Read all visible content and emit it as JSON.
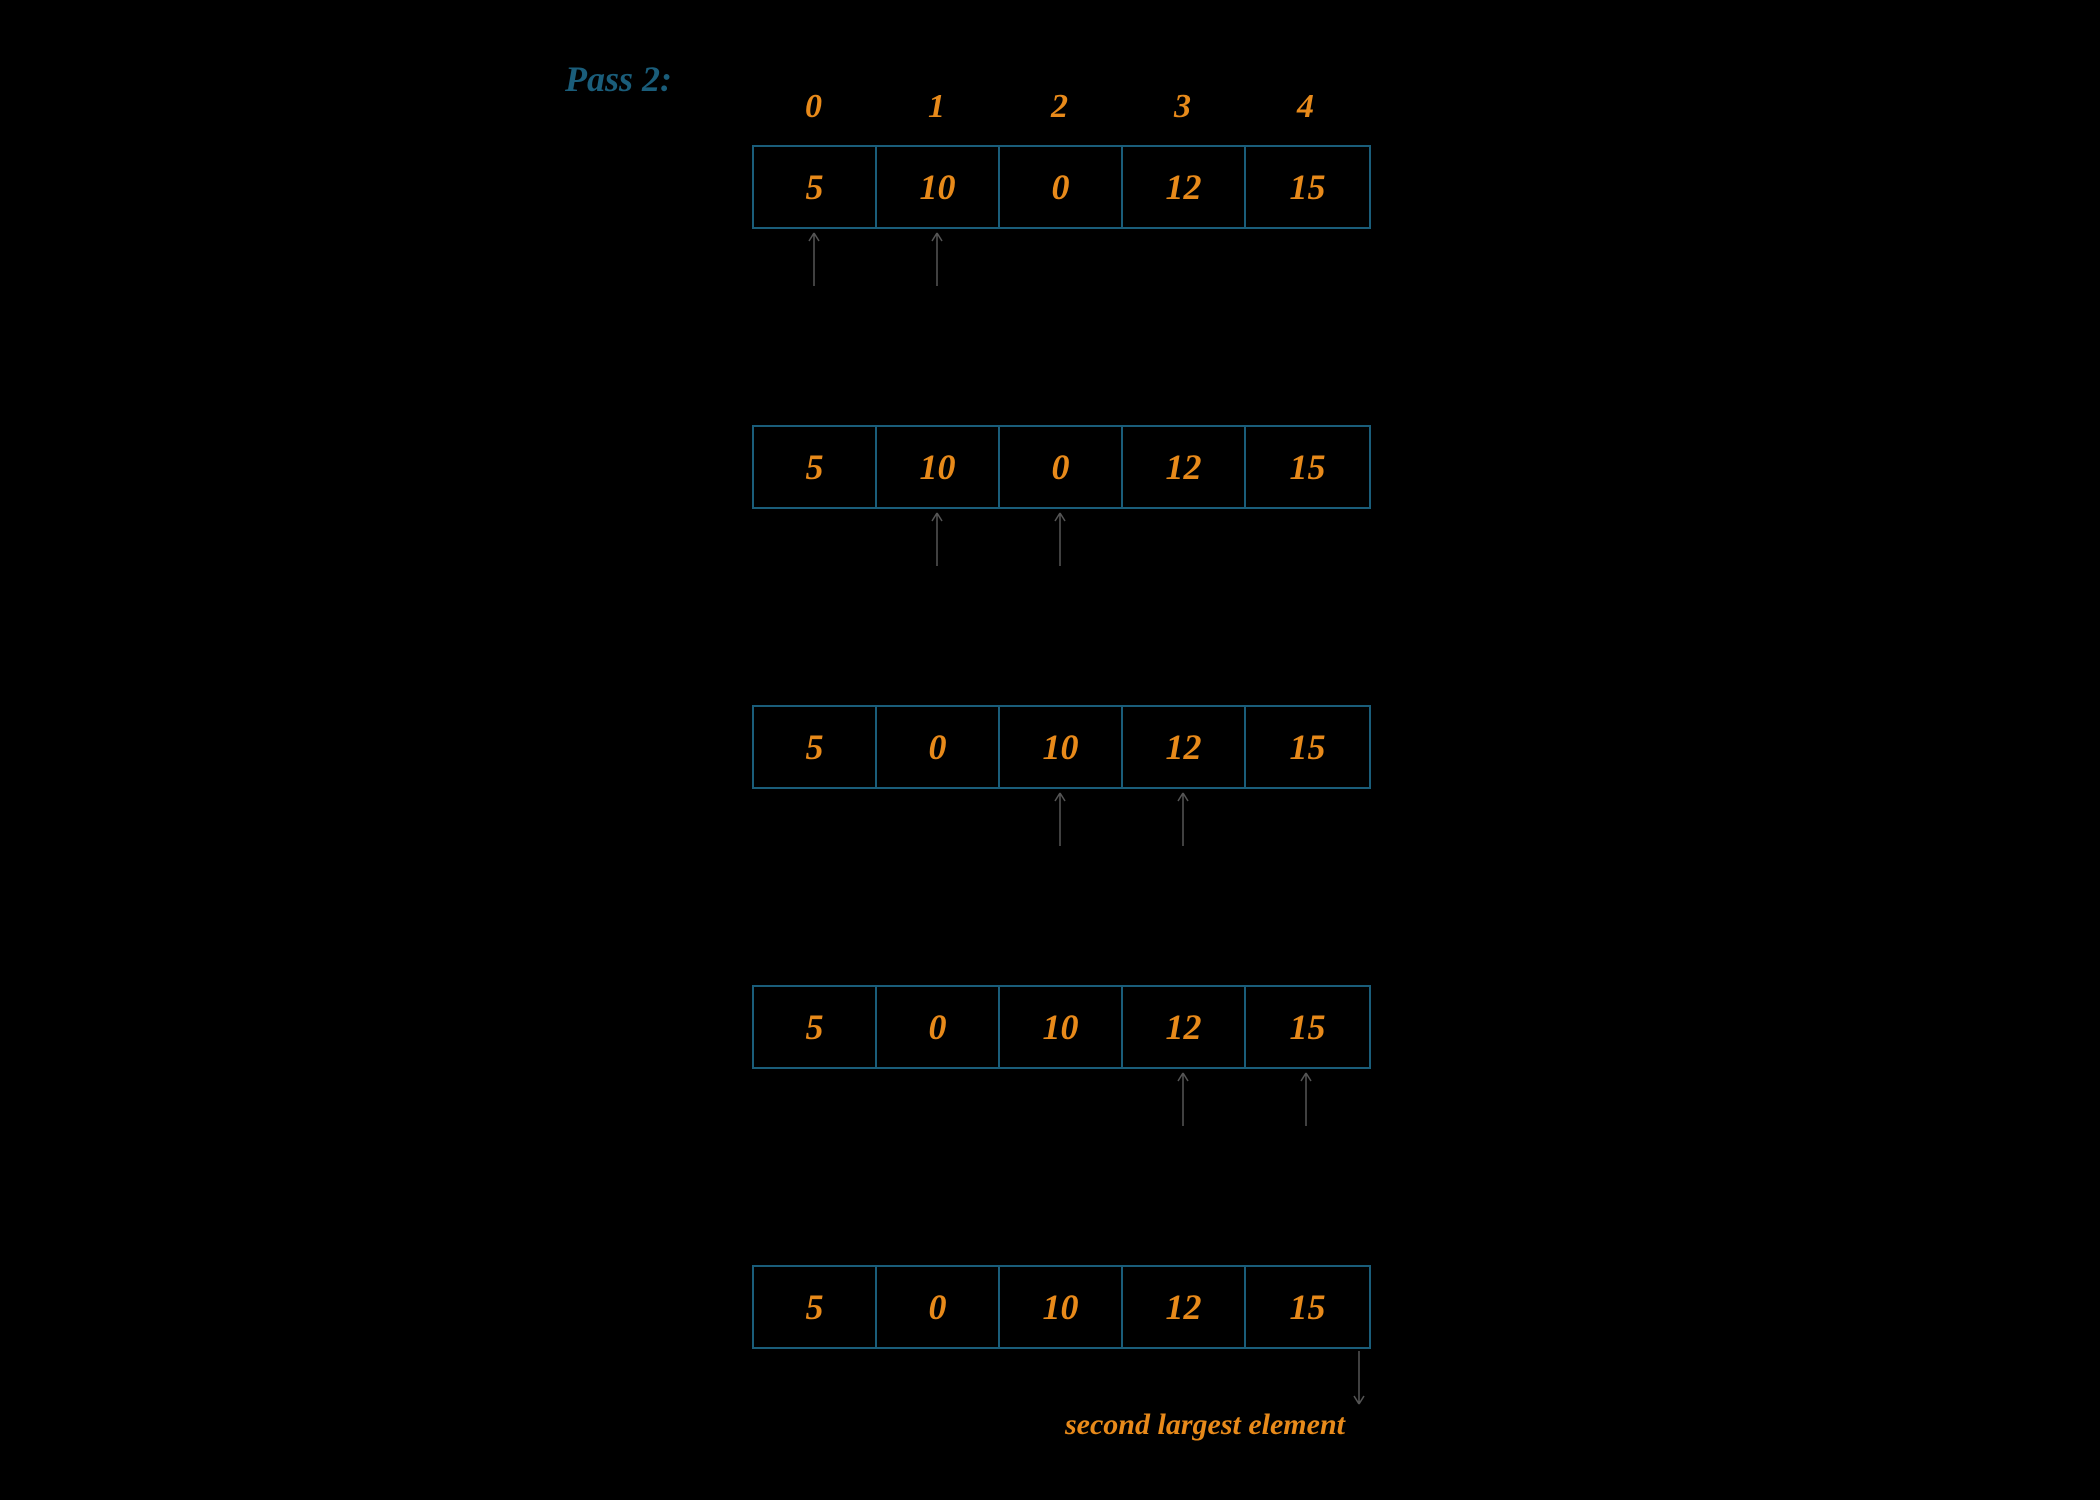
{
  "title": "Pass 2:",
  "indices": [
    "0",
    "1",
    "2",
    "3",
    "4"
  ],
  "rows": [
    {
      "values": [
        "5",
        "10",
        "0",
        "12",
        "15"
      ],
      "arrows": [
        0,
        1
      ]
    },
    {
      "values": [
        "5",
        "10",
        "0",
        "12",
        "15"
      ],
      "arrows": [
        1,
        2
      ]
    },
    {
      "values": [
        "5",
        "0",
        "10",
        "12",
        "15"
      ],
      "arrows": [
        2,
        3
      ]
    },
    {
      "values": [
        "5",
        "0",
        "10",
        "12",
        "15"
      ],
      "arrows": [
        3,
        4
      ]
    },
    {
      "values": [
        "5",
        "0",
        "10",
        "12",
        "15"
      ],
      "arrows": []
    }
  ],
  "caption": "second largest element",
  "colors": {
    "bg": "#000",
    "border": "#1a5d7a",
    "text": "#e88a1a",
    "title": "#1a5d7a",
    "arrow": "#555"
  }
}
